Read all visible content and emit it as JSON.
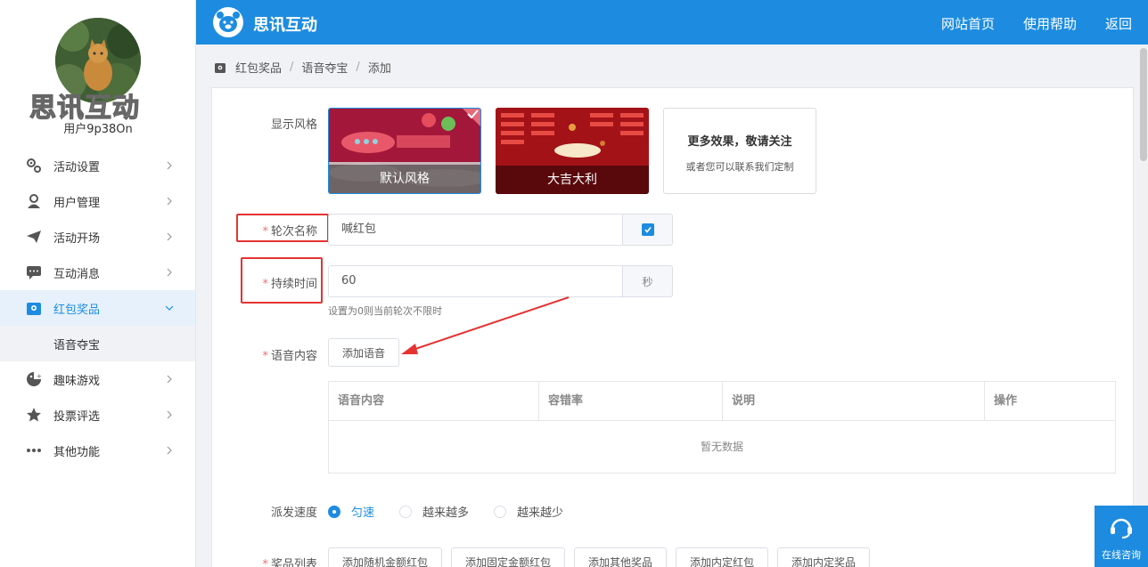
{
  "sidebar": {
    "brand": "思讯互动",
    "username": "用户9p38On",
    "items": [
      {
        "label": "活动设置",
        "icon": "gears-icon"
      },
      {
        "label": "用户管理",
        "icon": "user-icon"
      },
      {
        "label": "活动开场",
        "icon": "paper-plane-icon"
      },
      {
        "label": "互动消息",
        "icon": "chat-bubble-icon"
      },
      {
        "label": "红包奖品",
        "icon": "gift-box-icon"
      },
      {
        "label": "趣味游戏",
        "icon": "game-icon"
      },
      {
        "label": "投票评选",
        "icon": "star-icon"
      },
      {
        "label": "其他功能",
        "icon": "ellipsis-icon"
      }
    ],
    "active_sub": "语音夺宝"
  },
  "topbar": {
    "title": "思讯互动",
    "links": [
      "网站首页",
      "使用帮助",
      "返回"
    ]
  },
  "breadcrumb": [
    "红包奖品",
    "语音夺宝",
    "添加"
  ],
  "form": {
    "style_label": "显示风格",
    "styles": [
      {
        "name": "默认风格",
        "selected": true
      },
      {
        "name": "大吉大利",
        "selected": false
      }
    ],
    "more_title": "更多效果，敬请关注",
    "more_sub": "或者您可以联系我们定制",
    "round_label": "轮次名称",
    "round_value": "喊红包",
    "duration_label": "持续时间",
    "duration_value": "60",
    "duration_unit": "秒",
    "duration_hint": "设置为0则当前轮次不限时",
    "voice_label": "语音内容",
    "add_voice": "添加语音",
    "table_headers": [
      "语音内容",
      "容错率",
      "说明",
      "操作"
    ],
    "table_empty": "暂无数据",
    "speed_label": "派发速度",
    "speed_options": [
      {
        "label": "匀速",
        "checked": true
      },
      {
        "label": "越来越多",
        "checked": false
      },
      {
        "label": "越来越少",
        "checked": false
      }
    ],
    "prize_label": "奖品列表",
    "prize_buttons": [
      "添加随机金额红包",
      "添加固定金额红包",
      "添加其他奖品",
      "添加内定红包",
      "添加内定奖品"
    ]
  },
  "chat_widget": "在线咨询",
  "colors": {
    "primary": "#1d8ce0",
    "highlight": "#e53333",
    "required": "#f56c6c"
  }
}
